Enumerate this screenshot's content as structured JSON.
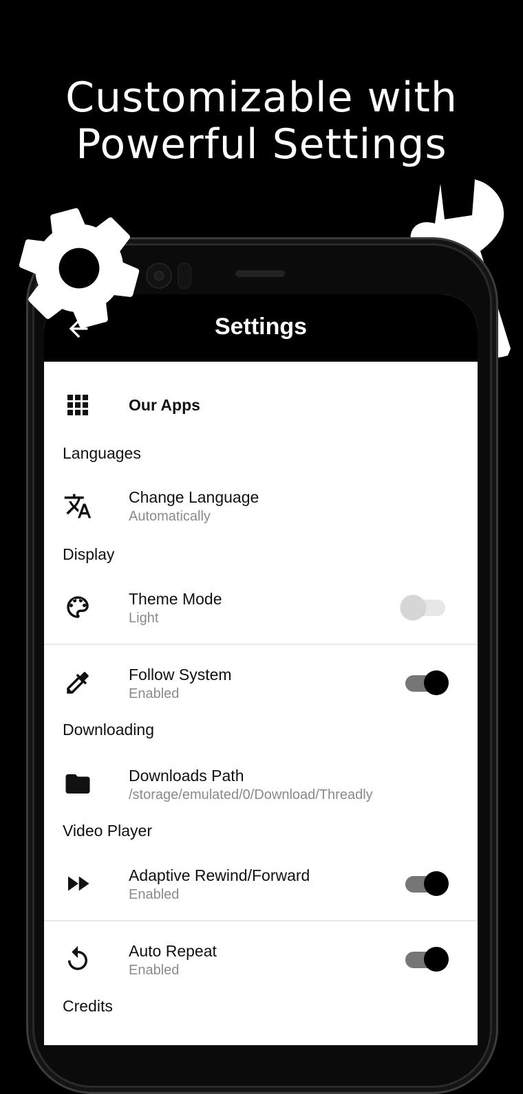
{
  "headline": {
    "line1": "Customizable with",
    "line2": "Powerful Settings"
  },
  "appbar": {
    "title": "Settings"
  },
  "items": {
    "our_apps": {
      "title": "Our Apps"
    },
    "change_language": {
      "title": "Change Language",
      "subtitle": "Automatically"
    },
    "theme_mode": {
      "title": "Theme Mode",
      "subtitle": "Light",
      "enabled": false
    },
    "follow_system": {
      "title": "Follow System",
      "subtitle": "Enabled",
      "enabled": true
    },
    "downloads_path": {
      "title": "Downloads Path",
      "subtitle": "/storage/emulated/0/Download/Threadly"
    },
    "adaptive_rewind": {
      "title": "Adaptive Rewind/Forward",
      "subtitle": "Enabled",
      "enabled": true
    },
    "auto_repeat": {
      "title": "Auto Repeat",
      "subtitle": "Enabled",
      "enabled": true
    }
  },
  "sections": {
    "languages": "Languages",
    "display": "Display",
    "downloading": "Downloading",
    "video_player": "Video Player",
    "credits": "Credits"
  },
  "icons": {
    "our_apps": "apps-grid-icon",
    "change_language": "translate-icon",
    "theme_mode": "palette-icon",
    "follow_system": "eyedropper-icon",
    "downloads_path": "folder-icon",
    "adaptive_rewind": "fast-forward-icon",
    "auto_repeat": "replay-icon"
  },
  "colors": {
    "background": "#000000",
    "screen": "#ffffff",
    "toggle_on": "#000000",
    "toggle_off": "#d6d6d6"
  }
}
